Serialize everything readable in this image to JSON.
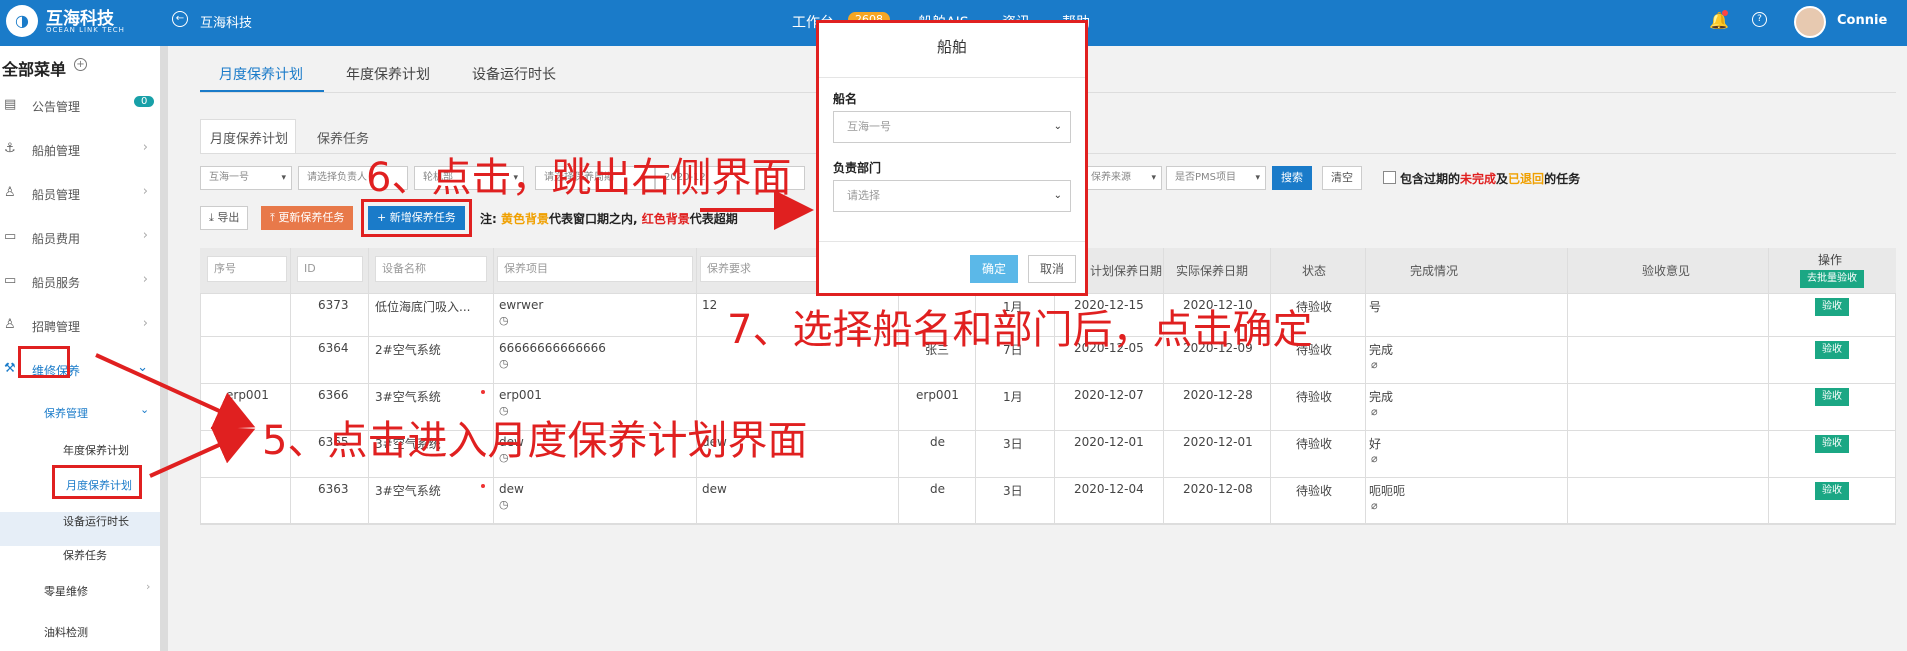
{
  "topbar": {
    "brand": "互海科技",
    "brand_sub": "OCEAN LINK TECH",
    "crumb": "互海科技",
    "nav": [
      "工作台",
      "船舶AIS",
      "资讯",
      "帮助"
    ],
    "badge": "2608",
    "user": "Connie"
  },
  "sidebar": {
    "title": "全部菜单",
    "items": [
      {
        "label": "公告管理",
        "icon": "doc-icon",
        "badge": "0"
      },
      {
        "label": "船舶管理",
        "icon": "anchor-icon"
      },
      {
        "label": "船员管理",
        "icon": "person-icon"
      },
      {
        "label": "船员费用",
        "icon": "wallet-icon"
      },
      {
        "label": "船员服务",
        "icon": "monitor-icon"
      },
      {
        "label": "招聘管理",
        "icon": "person-icon"
      },
      {
        "label": "维修保养",
        "icon": "wrench-icon"
      }
    ],
    "sub_group": "保养管理",
    "sub_items": [
      "年度保养计划",
      "月度保养计划",
      "设备运行时长",
      "保养任务"
    ],
    "more": [
      "零星维修",
      "油料检测"
    ]
  },
  "tabs_top": [
    "月度保养计划",
    "年度保养计划",
    "设备运行时长"
  ],
  "tabs_second": [
    "月度保养计划",
    "保养任务"
  ],
  "filters": {
    "ship": "互海一号",
    "dept": "请选择负责人",
    "f3": "轮机部",
    "f4": "请选择保养周期",
    "date": "2020-12",
    "source": "保养来源",
    "pms": "是否PMS项目",
    "search": "搜索",
    "clear": "清空",
    "overdue_pre": "包含过期的",
    "overdue_y": "未完成",
    "overdue_mid": "及",
    "overdue_r": "已退回",
    "overdue_post": "的任务"
  },
  "actions": {
    "export": "导出",
    "update": "更新保养任务",
    "add": "新增保养任务"
  },
  "note": {
    "pre": "注: ",
    "yellow": "黄色背景",
    "mid": "代表窗口期之内, ",
    "red": "红色背景",
    "post": "代表超期"
  },
  "table": {
    "headers": {
      "seq": "序号",
      "id": "ID",
      "device": "设备名称",
      "item": "保养项目",
      "req": "保养要求",
      "plan_date": "计划保养日期",
      "actual_date": "实际保养日期",
      "status": "状态",
      "done": "完成情况",
      "opinion": "验收意见",
      "op": "操作",
      "batch": "去批量验收"
    },
    "rows": [
      {
        "seq": "",
        "id": "6373",
        "device": "低位海底门吸入...",
        "item": "ewrwer",
        "req": "12",
        "person": "",
        "cycle": "1月",
        "plan": "2020-12-15",
        "actual": "2020-12-10",
        "status": "待验收",
        "done": "号",
        "clip": false
      },
      {
        "seq": "",
        "id": "6364",
        "device": "2#空气系统",
        "item": "66666666666666",
        "req": "",
        "person": "张三",
        "cycle": "7日",
        "plan": "2020-12-05",
        "actual": "2020-12-09",
        "status": "待验收",
        "done": "完成",
        "clip": true
      },
      {
        "seq": "erp001",
        "id": "6366",
        "device": "3#空气系统",
        "item": "erp001",
        "req": "",
        "person": "erp001",
        "cycle": "1月",
        "plan": "2020-12-07",
        "actual": "2020-12-28",
        "status": "待验收",
        "done": "完成",
        "clip": true
      },
      {
        "seq": "",
        "id": "6365",
        "device": "3#空气系统",
        "item": "dew",
        "req": "dew",
        "person": "de",
        "cycle": "3日",
        "plan": "2020-12-01",
        "actual": "2020-12-01",
        "status": "待验收",
        "done": "好",
        "clip": true
      },
      {
        "seq": "",
        "id": "6363",
        "device": "3#空气系统",
        "item": "dew",
        "req": "dew",
        "person": "de",
        "cycle": "3日",
        "plan": "2020-12-04",
        "actual": "2020-12-08",
        "status": "待验收",
        "done": "呃呃呃",
        "clip": true
      }
    ],
    "accept": "验收"
  },
  "modal": {
    "title": "船舶",
    "ship_label": "船名",
    "ship_value": "互海一号",
    "dept_label": "负责部门",
    "dept_placeholder": "请选择",
    "ok": "确定",
    "cancel": "取消"
  },
  "annotations": {
    "a5": "5、点击进入月度保养计划界面",
    "a6": "6、点击，跳出右侧界面",
    "a7": "7、选择船名和部门后，点击确定"
  },
  "colors": {
    "primary": "#1a7bc9",
    "annotation": "#e02020",
    "accept": "#1ba784"
  }
}
